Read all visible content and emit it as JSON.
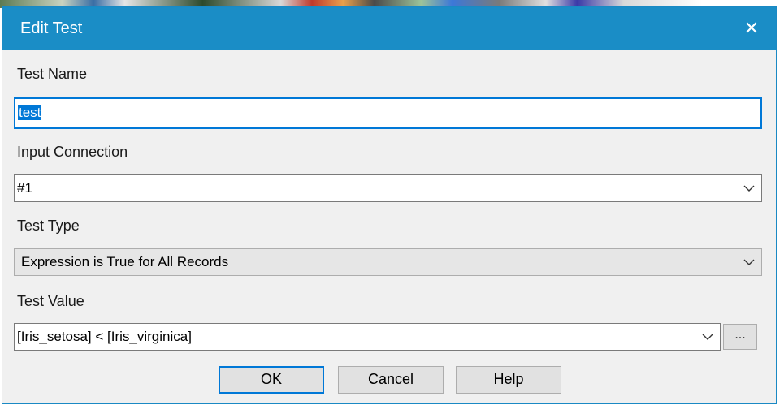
{
  "dialog": {
    "title": "Edit Test",
    "close_label": "✕"
  },
  "test_name": {
    "label": "Test Name",
    "value": "test"
  },
  "input_connection": {
    "label": "Input Connection",
    "value": "#1"
  },
  "test_type": {
    "label": "Test Type",
    "value": "Expression is True for All Records"
  },
  "test_value": {
    "label": "Test Value",
    "value": "[Iris_setosa] < [Iris_virginica]",
    "ellipsis_label": "..."
  },
  "buttons": {
    "ok": "OK",
    "cancel": "Cancel",
    "help": "Help"
  },
  "colors": {
    "titlebar": "#1a8dc6",
    "focus": "#0078d7"
  }
}
